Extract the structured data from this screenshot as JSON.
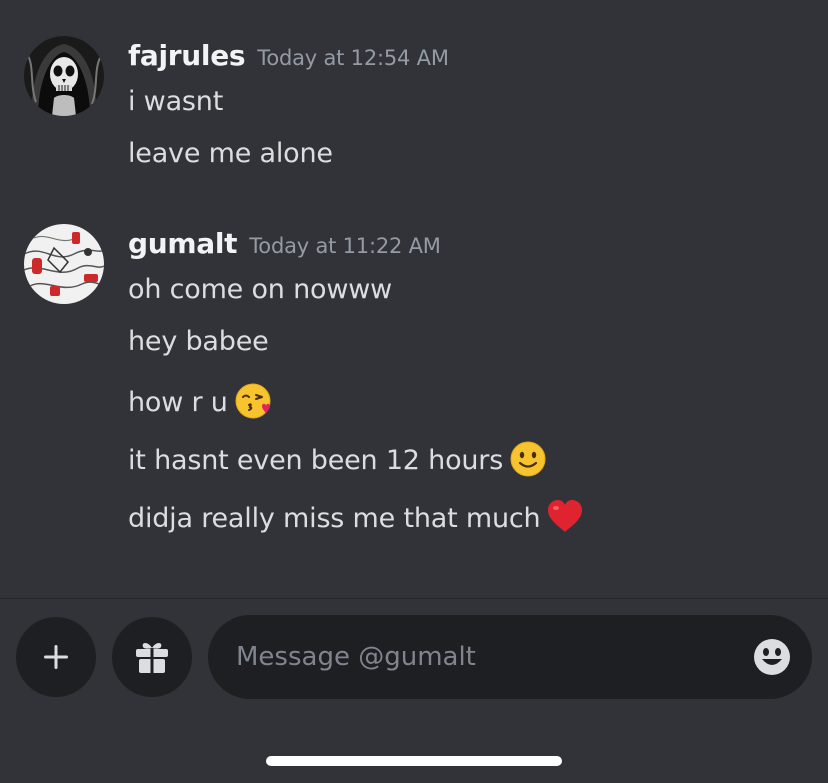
{
  "chat": {
    "groups": [
      {
        "username": "fajrules",
        "timestamp": "Today at 12:54 AM",
        "avatar": "skull-avatar",
        "messages": [
          {
            "text": "i wasnt"
          },
          {
            "text": "leave me alone"
          }
        ]
      },
      {
        "username": "gumalt",
        "timestamp": "Today at 11:22 AM",
        "avatar": "abstract-red-white-avatar",
        "messages": [
          {
            "text": "oh come on nowww"
          },
          {
            "text": "hey babee"
          },
          {
            "text": "how r u",
            "emoji": "face-blowing-a-kiss"
          },
          {
            "text": "it hasnt even been 12 hours",
            "emoji": "slightly-smiling-face"
          },
          {
            "text": "didja really miss me that much",
            "emoji": "red-heart"
          }
        ]
      }
    ]
  },
  "composer": {
    "placeholder": "Message @gumalt",
    "value": "",
    "buttons": {
      "add": "plus-icon",
      "gift": "gift-icon",
      "emoji": "emoji-icon"
    }
  },
  "colors": {
    "background": "#313338",
    "input_background": "#1e1f22",
    "username": "#f2f3f5",
    "message_text": "#dbdee1",
    "timestamp": "#949ba4",
    "placeholder": "#80848e"
  }
}
